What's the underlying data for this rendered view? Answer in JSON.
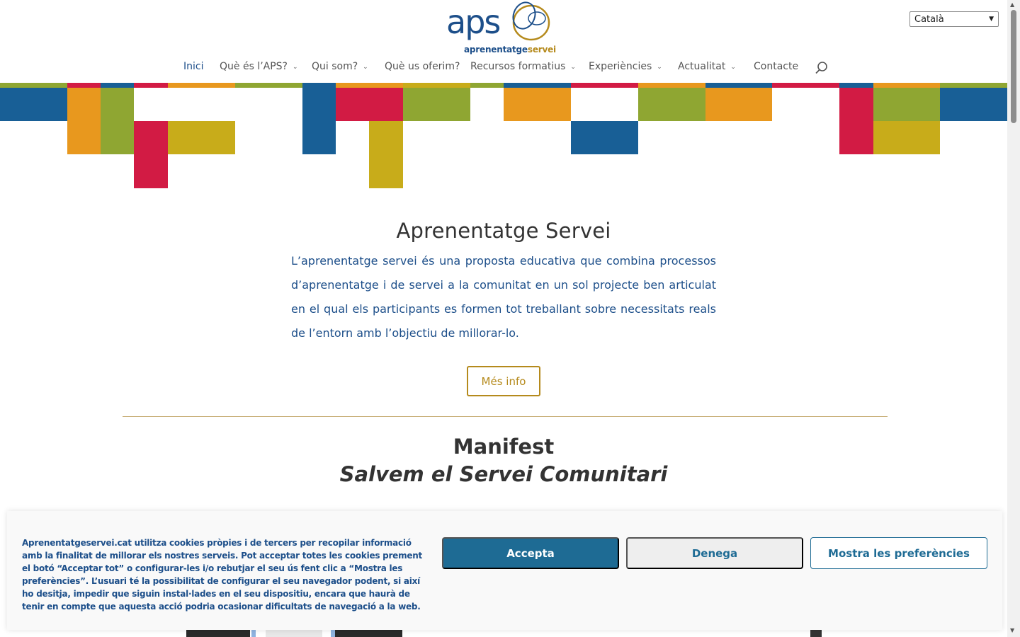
{
  "language_select": {
    "value": "Català"
  },
  "logo": {
    "main": "aps",
    "sub_primary": "aprenentatge",
    "sub_accent": "servei"
  },
  "nav": {
    "items": [
      {
        "label": "Inici",
        "active": true,
        "dropdown": false
      },
      {
        "label": "Què és l’APS?",
        "active": false,
        "dropdown": true
      },
      {
        "label": "Qui som?",
        "active": false,
        "dropdown": true
      },
      {
        "label": "Què us oferim?",
        "active": false,
        "dropdown": false
      },
      {
        "label": "Recursos formatius",
        "active": false,
        "dropdown": true
      },
      {
        "label": "Experiències",
        "active": false,
        "dropdown": true
      },
      {
        "label": "Actualitat",
        "active": false,
        "dropdown": true
      },
      {
        "label": "Contacte",
        "active": false,
        "dropdown": false
      }
    ],
    "search_icon": "search-icon"
  },
  "main": {
    "title": "Aprenentatge Servei",
    "intro": "L’aprenentatge servei és una proposta educativa que combina processos d’aprenentatge i de servei a la comunitat en un sol projecte ben articulat en el qual els participants es formen tot treballant sobre necessitats reals de l’entorn amb l’objectiu de millorar-lo.",
    "more_button": "Més info"
  },
  "manifest": {
    "title": "Manifest",
    "subtitle": "Salvem el Servei Comunitari"
  },
  "cookie_banner": {
    "text": "Aprenentatgeservei.cat utilitza cookies pròpies i de tercers per recopilar informació amb la finalitat de millorar els nostres serveis. Pot acceptar totes les cookies prement el botó “Acceptar tot” o configurar-les i/o rebutjar el seu ús fent clic a “Mostra les preferències”. L’usuari té la possibilitat de configurar el seu navegador podent, si així ho desitja, impedir que siguin instal·lades en el seu dispositiu, encara que haurà de tenir en compte que aquesta acció podria ocasionar dificultats de navegació a la web.",
    "accept": "Accepta",
    "deny": "Denega",
    "preferences": "Mostra les preferències"
  },
  "colors": {
    "brand_blue": "#1d4f8a",
    "accent_gold": "#b58a1c",
    "button_blue": "#1e6b94",
    "mosaic_blue": "#185f96",
    "mosaic_orange": "#e8981e",
    "mosaic_green": "#8fa632",
    "mosaic_red": "#d21b44",
    "mosaic_yellow": "#c8ac1a"
  }
}
